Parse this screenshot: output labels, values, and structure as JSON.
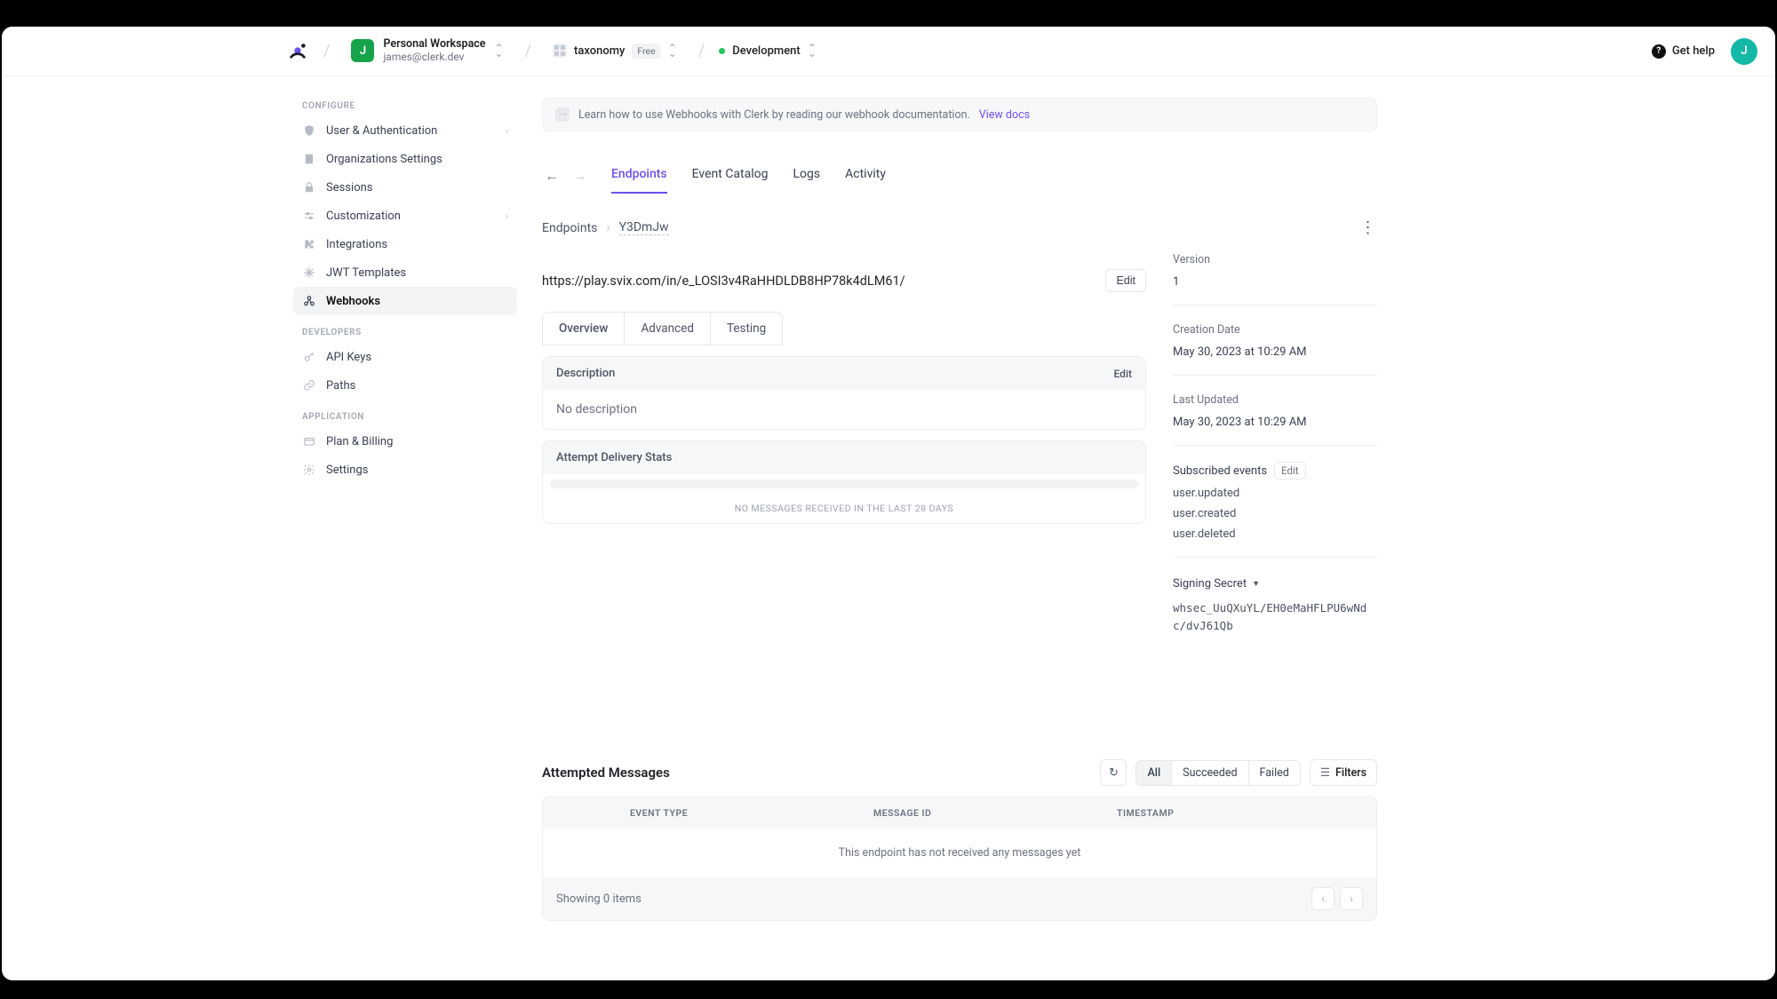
{
  "topbar": {
    "workspace": {
      "initial": "J",
      "name": "Personal Workspace",
      "email": "james@clerk.dev"
    },
    "app": {
      "name": "taxonomy",
      "plan": "Free"
    },
    "env": "Development",
    "help": "Get help",
    "avatar_initial": "J"
  },
  "sidebar": {
    "configure_label": "CONFIGURE",
    "configure": [
      {
        "label": "User & Authentication",
        "chev": true
      },
      {
        "label": "Organizations Settings"
      },
      {
        "label": "Sessions"
      },
      {
        "label": "Customization",
        "chev": true
      },
      {
        "label": "Integrations"
      },
      {
        "label": "JWT Templates"
      },
      {
        "label": "Webhooks",
        "active": true
      }
    ],
    "developers_label": "DEVELOPERS",
    "developers": [
      {
        "label": "API Keys"
      },
      {
        "label": "Paths"
      }
    ],
    "application_label": "APPLICATION",
    "application": [
      {
        "label": "Plan & Billing"
      },
      {
        "label": "Settings"
      }
    ]
  },
  "banner": {
    "text": "Learn how to use Webhooks with Clerk by reading our webhook documentation.",
    "link": "View docs"
  },
  "tabs": [
    "Endpoints",
    "Event Catalog",
    "Logs",
    "Activity"
  ],
  "crumbs": {
    "root": "Endpoints",
    "id": "Y3DmJw"
  },
  "endpoint": {
    "url": "https://play.svix.com/in/e_LOSI3v4RaHHDLDB8HP78k4dLM61/",
    "edit": "Edit"
  },
  "subtabs": [
    "Overview",
    "Advanced",
    "Testing"
  ],
  "description_card": {
    "title": "Description",
    "edit": "Edit",
    "body": "No description"
  },
  "stats_card": {
    "title": "Attempt Delivery Stats",
    "msg": "NO MESSAGES RECEIVED IN THE LAST 28 DAYS"
  },
  "meta": {
    "version_label": "Version",
    "version": "1",
    "creation_label": "Creation Date",
    "creation": "May 30, 2023 at 10:29 AM",
    "updated_label": "Last Updated",
    "updated": "May 30, 2023 at 10:29 AM",
    "events_label": "Subscribed events",
    "events_edit": "Edit",
    "events": [
      "user.updated",
      "user.created",
      "user.deleted"
    ],
    "secret_label": "Signing Secret",
    "secret": "whsec_UuQXuYL/EH0eMaHFLPU6wNdc/dvJ61Qb"
  },
  "attempted": {
    "title": "Attempted Messages",
    "filters_label": "Filters",
    "seg": [
      "All",
      "Succeeded",
      "Failed"
    ],
    "columns": [
      "EVENT TYPE",
      "MESSAGE ID",
      "TIMESTAMP"
    ],
    "empty": "This endpoint has not received any messages yet",
    "footer": "Showing 0 items"
  }
}
